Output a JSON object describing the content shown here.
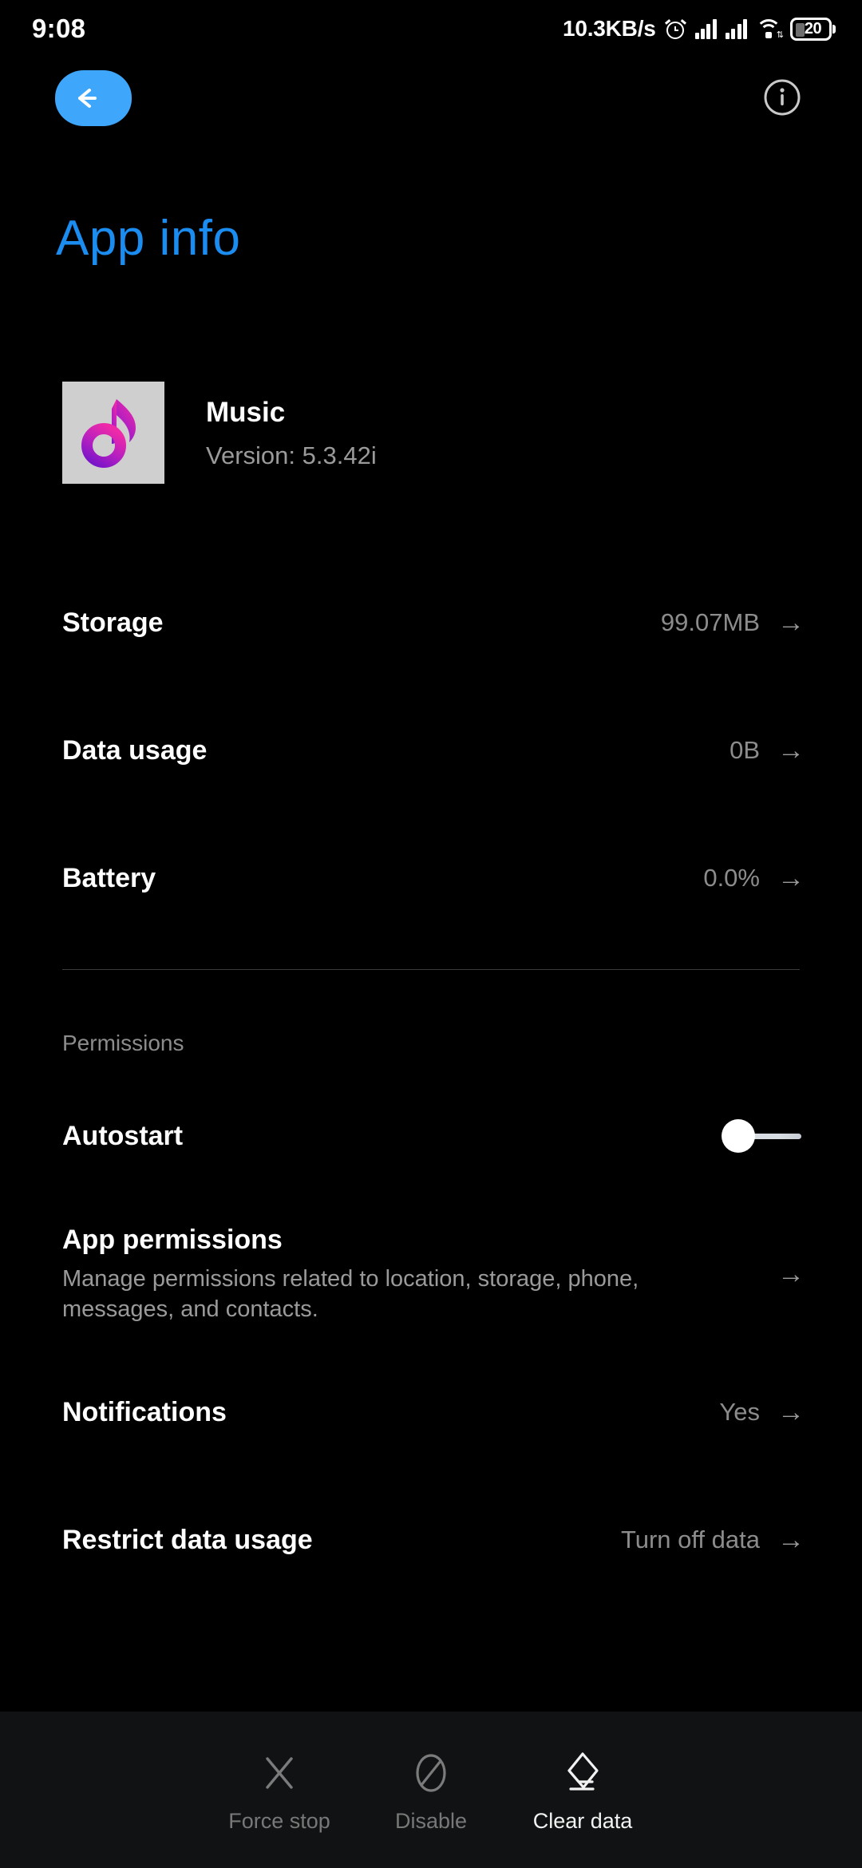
{
  "status_bar": {
    "time": "9:08",
    "network_speed": "10.3KB/s",
    "alarm_icon": "alarm-clock-icon",
    "signal_icon": "cellular-signal-icon",
    "wifi_icon": "wifi-icon",
    "battery_level": "20",
    "battery_icon": "battery-icon"
  },
  "top_bar": {
    "back_icon": "back-arrow-icon",
    "back_accent_color": "#3ea6fb",
    "info_icon": "info-circle-icon"
  },
  "page": {
    "title": "App info",
    "title_color": "#1b8df0"
  },
  "app": {
    "icon": "music-note-icon",
    "icon_bg_color": "#cfcfcf",
    "icon_gradient_from": "#ef2aa8",
    "icon_gradient_to": "#7b15c8",
    "name": "Music",
    "version": "Version: 5.3.42i"
  },
  "info_rows": [
    {
      "title": "Storage",
      "value": "99.07MB",
      "arrow": "chevron-right-icon"
    },
    {
      "title": "Data usage",
      "value": "0B",
      "arrow": "chevron-right-icon"
    },
    {
      "title": "Battery",
      "value": "0.0%",
      "arrow": "chevron-right-icon"
    }
  ],
  "permissions_section": {
    "label": "Permissions",
    "autostart": {
      "title": "Autostart",
      "toggle_state": "off",
      "toggle_thumb_color": "#ffffff",
      "toggle_track_color": "#d8dde3"
    },
    "app_permissions": {
      "title": "App permissions",
      "subtitle": "Manage permissions related to location, storage, phone, messages, and contacts.",
      "arrow": "chevron-right-icon"
    },
    "rows": [
      {
        "title": "Notifications",
        "value": "Yes",
        "arrow": "chevron-right-icon"
      },
      {
        "title": "Restrict data usage",
        "value": "Turn off data",
        "arrow": "chevron-right-icon"
      }
    ]
  },
  "bottom_bar": {
    "actions": [
      {
        "label": "Force stop",
        "icon": "close-x-icon",
        "state": "disabled"
      },
      {
        "label": "Disable",
        "icon": "block-circle-icon",
        "state": "disabled"
      },
      {
        "label": "Clear data",
        "icon": "eraser-icon",
        "state": "enabled"
      }
    ]
  }
}
